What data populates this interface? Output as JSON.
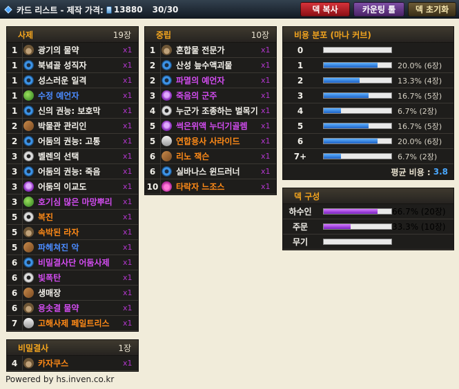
{
  "topbar": {
    "title": "카드 리스트 - 제작 가격:",
    "dust": "13880",
    "count": "30/30",
    "buttons": {
      "copy": "덱 복사",
      "counting": "카운팅 툴",
      "reset": "덱 초기화"
    }
  },
  "class_panel": {
    "title": "사제",
    "count": "19장",
    "cards": [
      {
        "cost": "1",
        "name": "광기의 물약",
        "qty": "x1",
        "quality": "common",
        "icon": "paw"
      },
      {
        "cost": "1",
        "name": "북녘골 성직자",
        "qty": "x1",
        "quality": "common",
        "icon": "swirl"
      },
      {
        "cost": "1",
        "name": "성스러운 일격",
        "qty": "x1",
        "quality": "common",
        "icon": "swirl"
      },
      {
        "cost": "1",
        "name": "수정 예언자",
        "qty": "x1",
        "quality": "rare",
        "icon": "leaf"
      },
      {
        "cost": "1",
        "name": "신의 권능: 보호막",
        "qty": "x1",
        "quality": "common",
        "icon": "swirl"
      },
      {
        "cost": "2",
        "name": "박물관 관리인",
        "qty": "x1",
        "quality": "common",
        "icon": "boot"
      },
      {
        "cost": "2",
        "name": "어둠의 권능: 고통",
        "qty": "x1",
        "quality": "common",
        "icon": "swirl"
      },
      {
        "cost": "3",
        "name": "벨렌의 선택",
        "qty": "x1",
        "quality": "common",
        "icon": "gear"
      },
      {
        "cost": "3",
        "name": "어둠의 권능: 죽음",
        "qty": "x1",
        "quality": "common",
        "icon": "swirl"
      },
      {
        "cost": "3",
        "name": "어둠의 이교도",
        "qty": "x1",
        "quality": "common",
        "icon": "skull"
      },
      {
        "cost": "3",
        "name": "호기심 많은 마망뿌리",
        "qty": "x1",
        "quality": "epic",
        "icon": "leaf"
      },
      {
        "cost": "5",
        "name": "복진",
        "qty": "x1",
        "quality": "legendary",
        "icon": "gear"
      },
      {
        "cost": "5",
        "name": "속박된 라자",
        "qty": "x1",
        "quality": "legendary",
        "icon": "paw"
      },
      {
        "cost": "5",
        "name": "파헤쳐진 악",
        "qty": "x1",
        "quality": "rare",
        "icon": "boot"
      },
      {
        "cost": "6",
        "name": "비밀결사단 어둠사제",
        "qty": "x1",
        "quality": "epic",
        "icon": "swirl"
      },
      {
        "cost": "6",
        "name": "빛폭탄",
        "qty": "x1",
        "quality": "epic",
        "icon": "gear"
      },
      {
        "cost": "6",
        "name": "생매장",
        "qty": "x1",
        "quality": "common",
        "icon": "boot"
      },
      {
        "cost": "6",
        "name": "용솟결 물약",
        "qty": "x1",
        "quality": "epic",
        "icon": "paw"
      },
      {
        "cost": "7",
        "name": "고해사제 페일트리스",
        "qty": "x1",
        "quality": "legendary",
        "icon": "shield"
      }
    ]
  },
  "neutral_panel": {
    "title": "중립",
    "count": "10장",
    "cards": [
      {
        "cost": "1",
        "name": "혼합물 전문가",
        "qty": "x1",
        "quality": "common",
        "icon": "paw"
      },
      {
        "cost": "2",
        "name": "산성 늪수액괴물",
        "qty": "x1",
        "quality": "common",
        "icon": "swirl"
      },
      {
        "cost": "2",
        "name": "파멸의 예언자",
        "qty": "x1",
        "quality": "epic",
        "icon": "swirl"
      },
      {
        "cost": "3",
        "name": "죽음의 군주",
        "qty": "x1",
        "quality": "epic",
        "icon": "skull"
      },
      {
        "cost": "4",
        "name": "누군가 조종하는 벌목기",
        "qty": "x1",
        "quality": "common",
        "icon": "gear"
      },
      {
        "cost": "5",
        "name": "썩은위액 누더기골렘",
        "qty": "x1",
        "quality": "epic",
        "icon": "skull"
      },
      {
        "cost": "5",
        "name": "연합용사 사라이드",
        "qty": "x1",
        "quality": "legendary",
        "icon": "shield"
      },
      {
        "cost": "6",
        "name": "리노 잭슨",
        "qty": "x1",
        "quality": "legendary",
        "icon": "boot"
      },
      {
        "cost": "6",
        "name": "실바나스 윈드러너",
        "qty": "x1",
        "quality": "common",
        "icon": "swirl"
      },
      {
        "cost": "10",
        "name": "타락자 느조스",
        "qty": "x1",
        "quality": "legendary",
        "icon": "tent"
      }
    ]
  },
  "secret_panel": {
    "title": "비밀결사",
    "count": "1장",
    "cards": [
      {
        "cost": "4",
        "name": "카자쿠스",
        "qty": "x1",
        "quality": "legendary",
        "icon": "paw"
      }
    ]
  },
  "mana_panel": {
    "title": "비용 분포 (마나 커브)",
    "rows": [
      {
        "label": "0",
        "fraction": 0,
        "text": ""
      },
      {
        "label": "1",
        "fraction": 0.8,
        "text": "20.0% (6장)"
      },
      {
        "label": "2",
        "fraction": 0.53,
        "text": "13.3% (4장)"
      },
      {
        "label": "3",
        "fraction": 0.66,
        "text": "16.7% (5장)"
      },
      {
        "label": "4",
        "fraction": 0.26,
        "text": "6.7% (2장)"
      },
      {
        "label": "5",
        "fraction": 0.66,
        "text": "16.7% (5장)"
      },
      {
        "label": "6",
        "fraction": 0.8,
        "text": "20.0% (6장)"
      },
      {
        "label": "7+",
        "fraction": 0.26,
        "text": "6.7% (2장)"
      }
    ],
    "avg_label": "평균 비용 :",
    "avg_value": "3.8"
  },
  "composition_panel": {
    "title": "덱 구성",
    "rows": [
      {
        "label": "하수인",
        "fraction": 0.8,
        "text": "66.7% (20장)"
      },
      {
        "label": "주문",
        "fraction": 0.4,
        "text": "33.3% (10장)"
      },
      {
        "label": "무기",
        "fraction": 0,
        "text": ""
      }
    ]
  },
  "footer": "Powered by hs.inven.co.kr"
}
